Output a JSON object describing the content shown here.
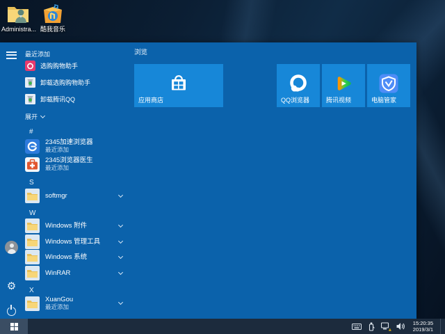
{
  "desktop": {
    "icons": [
      {
        "label": "Administra...",
        "icon": "user-folder-icon"
      },
      {
        "label": "酷我音乐",
        "icon": "kuwo-music-icon"
      }
    ]
  },
  "start_menu": {
    "recent_header": "最近添加",
    "recent_items": [
      {
        "label": "选购购物助手",
        "icon": "shopping-bag-icon"
      },
      {
        "label": "卸载选购购物助手",
        "icon": "uninstall-trash-icon"
      },
      {
        "label": "卸载腾讯QQ",
        "icon": "uninstall-trash-icon"
      }
    ],
    "expand_label": "展开",
    "app_sections": [
      {
        "letter": "#",
        "apps": [
          {
            "name": "2345加速浏览器",
            "sub": "最近添加",
            "icon": "2345-browser-icon"
          },
          {
            "name": "2345浏览器医生",
            "sub": "最近添加",
            "icon": "first-aid-kit-icon"
          }
        ]
      },
      {
        "letter": "S",
        "apps": [
          {
            "name": "softmgr",
            "icon": "folder-icon"
          }
        ]
      },
      {
        "letter": "W",
        "apps": [
          {
            "name": "Windows 附件",
            "icon": "folder-icon"
          },
          {
            "name": "Windows 管理工具",
            "icon": "folder-icon"
          },
          {
            "name": "Windows 系统",
            "icon": "folder-icon"
          },
          {
            "name": "WinRAR",
            "icon": "folder-icon"
          }
        ]
      },
      {
        "letter": "X",
        "apps": [
          {
            "name": "XuanGou",
            "sub": "最近添加",
            "icon": "folder-icon"
          }
        ]
      }
    ],
    "tile_group_header": "浏览",
    "tiles": [
      {
        "label": "应用商店",
        "icon": "store-icon",
        "size": "wide"
      },
      {
        "label": "QQ浏览器",
        "icon": "qq-browser-icon",
        "size": "medium"
      },
      {
        "label": "腾讯视频",
        "icon": "tencent-video-icon",
        "size": "medium"
      },
      {
        "label": "电脑管家",
        "icon": "pc-manager-shield-icon",
        "size": "medium"
      }
    ]
  },
  "taskbar": {
    "tray_icons": [
      "touch-keyboard-icon",
      "usb-device-icon",
      "network-warning-icon",
      "volume-icon"
    ],
    "clock_time": "15:20:35",
    "clock_date": "2019/3/1"
  },
  "colors": {
    "menu_bg": "#0b62ab",
    "tile_bg": "#1787d8",
    "taskbar_bg": "#1c2b3d",
    "wallpaper": "#0b1e33"
  }
}
